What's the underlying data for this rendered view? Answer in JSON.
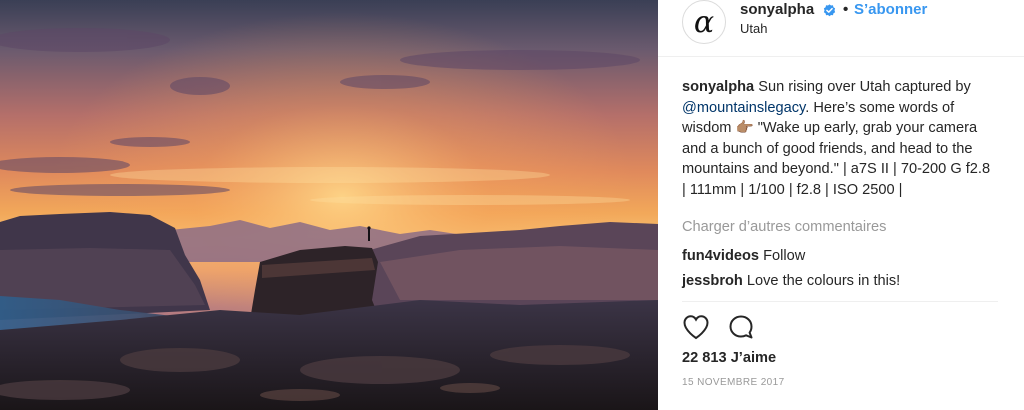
{
  "post": {
    "photo_alt": "Sun rising over Utah",
    "header": {
      "avatar_glyph": "α",
      "username": "sonyalpha",
      "verified_icon": "verified-badge-icon",
      "separator": "•",
      "follow_label": "S’abonner",
      "location": "Utah"
    },
    "caption": {
      "username": "sonyalpha",
      "text_before_mention": " Sun rising over Utah captured by ",
      "mention": "@mountainslegacy",
      "text_after_mention": ". Here’s some words of wisdom 👉🏽 \"Wake up early, grab your camera and a bunch of good friends, and head to the mountains and beyond.\" | a7S II | 70-200 G f2.8 | 111mm | 1/100 | f2.8 | ISO 2500 |"
    },
    "load_more_label": "Charger d’autres commentaires",
    "comments": [
      {
        "username": "fun4videos",
        "text": " Follow"
      },
      {
        "username": "jessbroh",
        "text": " Love the colours in this!"
      }
    ],
    "actions": {
      "like_icon": "heart-icon",
      "comment_icon": "comment-icon"
    },
    "likes": "22 813 J’aime",
    "date": "15 NOVEMBRE 2017",
    "colors": {
      "link": "#3897f0",
      "mention": "#003569",
      "muted": "#999999"
    }
  }
}
